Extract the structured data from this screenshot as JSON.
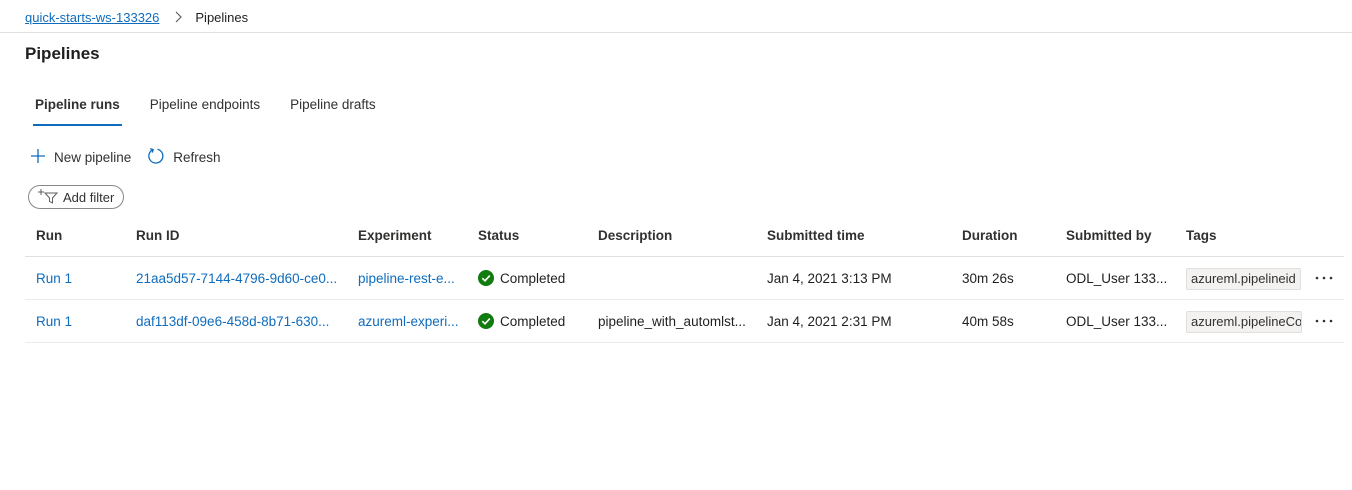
{
  "breadcrumb": {
    "workspace": "quick-starts-ws-133326",
    "current": "Pipelines"
  },
  "page": {
    "title": "Pipelines"
  },
  "tabs": [
    {
      "label": "Pipeline runs",
      "active": true
    },
    {
      "label": "Pipeline endpoints",
      "active": false
    },
    {
      "label": "Pipeline drafts",
      "active": false
    }
  ],
  "toolbar": {
    "new_pipeline": "New pipeline",
    "refresh": "Refresh",
    "add_filter": "Add filter"
  },
  "table": {
    "columns": [
      "Run",
      "Run ID",
      "Experiment",
      "Status",
      "Description",
      "Submitted time",
      "Duration",
      "Submitted by",
      "Tags"
    ],
    "rows": [
      {
        "run": "Run 1",
        "run_id": "21aa5d57-7144-4796-9d60-ce0...",
        "experiment": "pipeline-rest-e...",
        "status": "Completed",
        "description": "",
        "submitted_time": "Jan 4, 2021 3:13 PM",
        "duration": "30m 26s",
        "submitted_by": "ODL_User 133...",
        "tag": "azureml.pipelineid"
      },
      {
        "run": "Run 1",
        "run_id": "daf113df-09e6-458d-8b71-630...",
        "experiment": "azureml-experi...",
        "status": "Completed",
        "description": "pipeline_with_automlst...",
        "submitted_time": "Jan 4, 2021 2:31 PM",
        "duration": "40m 58s",
        "submitted_by": "ODL_User 133...",
        "tag": "azureml.pipelineComponent"
      }
    ]
  },
  "colors": {
    "accent": "#0f6cbd",
    "success": "#107c10",
    "text": "#201f1e",
    "divider": "#e1dfdd"
  },
  "icons": {
    "breadcrumb_separator": "chevron-right-icon",
    "new_pipeline": "plus-icon",
    "refresh": "refresh-icon",
    "add_filter": "filter-add-icon",
    "status_completed": "checkmark-circle-icon",
    "row_actions": "more-horizontal-icon"
  }
}
